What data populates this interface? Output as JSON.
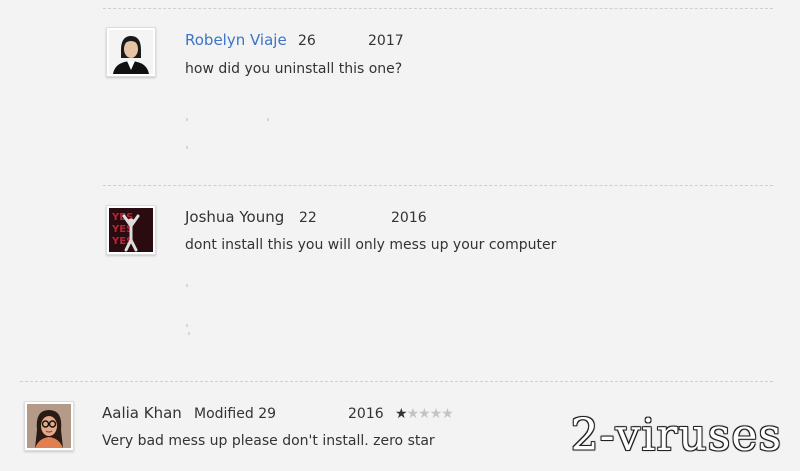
{
  "comments": [
    {
      "author": "Robelyn Viaje",
      "date_day": "26",
      "date_year": "2017",
      "text": "how did you uninstall this one?",
      "avatar_icon": "avatar-woman-photo"
    },
    {
      "author": "Joshua Young",
      "date_day": "22",
      "date_year": "2016",
      "text": "dont install this you will only mess up your computer",
      "avatar_icon": "avatar-yes-poster"
    },
    {
      "author": "Aalia Khan",
      "modified_label": "Modified 29",
      "date_year": "2016",
      "rating": {
        "value": 1,
        "max": 5
      },
      "text": "Very bad mess up please don't install. zero star",
      "avatar_icon": "avatar-woman-glasses-photo"
    }
  ],
  "watermark": "2-viruses",
  "colors": {
    "background": "#f3f3f3",
    "link_author": "#3b73c8",
    "text": "#333333",
    "divider": "#cfcfcf"
  }
}
